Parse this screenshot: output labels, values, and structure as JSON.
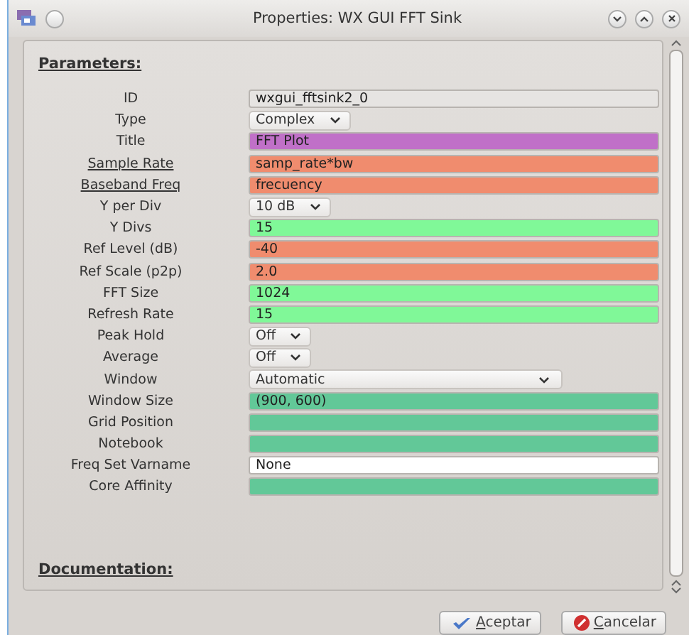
{
  "window": {
    "title": "Properties: WX GUI FFT Sink"
  },
  "parameters_heading": "Parameters:",
  "parameters": [
    {
      "label": "ID",
      "kind": "entry",
      "value": "wxgui_fftsink2_0",
      "color": "#e6e4e2",
      "underlined": false
    },
    {
      "label": "Type",
      "kind": "dropdown",
      "value": "Complex",
      "underlined": false
    },
    {
      "label": "Title",
      "kind": "entry",
      "value": "FFT Plot",
      "color": "#c070c8",
      "underlined": false
    },
    {
      "label": "Sample Rate",
      "kind": "entry",
      "value": "samp_rate*bw",
      "color": "#f08c6e",
      "underlined": true
    },
    {
      "label": "Baseband Freq",
      "kind": "entry",
      "value": "frecuency",
      "color": "#f08c6e",
      "underlined": true
    },
    {
      "label": "Y per Div",
      "kind": "dropdown",
      "value": "10 dB",
      "underlined": false
    },
    {
      "label": "Y Divs",
      "kind": "entry",
      "value": "15",
      "color": "#80f898",
      "underlined": false
    },
    {
      "label": "Ref Level (dB)",
      "kind": "entry",
      "value": "-40",
      "color": "#f08c6e",
      "underlined": false
    },
    {
      "label": "Ref Scale (p2p)",
      "kind": "entry",
      "value": "2.0",
      "color": "#f08c6e",
      "underlined": false
    },
    {
      "label": "FFT Size",
      "kind": "entry",
      "value": "1024",
      "color": "#80f898",
      "underlined": false
    },
    {
      "label": "Refresh Rate",
      "kind": "entry",
      "value": "15",
      "color": "#80f898",
      "underlined": false
    },
    {
      "label": "Peak Hold",
      "kind": "dropdown",
      "value": "Off",
      "underlined": false
    },
    {
      "label": "Average",
      "kind": "dropdown",
      "value": "Off",
      "underlined": false
    },
    {
      "label": "Window",
      "kind": "dropdown",
      "value": "Automatic",
      "underlined": false
    },
    {
      "label": "Window Size",
      "kind": "entry",
      "value": "(900, 600)",
      "color": "#62c898",
      "underlined": false
    },
    {
      "label": "Grid Position",
      "kind": "entry",
      "color": "#62c898",
      "underlined": false
    },
    {
      "label": "Notebook",
      "kind": "entry",
      "color": "#62c898",
      "underlined": false
    },
    {
      "label": "Freq Set Varname",
      "kind": "entry",
      "value": "None",
      "color": "#ffffff",
      "underlined": false
    },
    {
      "label": "Core Affinity",
      "kind": "entry",
      "color": "#62c898",
      "underlined": false
    }
  ],
  "documentation_heading": "Documentation:",
  "buttons": [
    {
      "label": "Aceptar",
      "kind": "accept"
    },
    {
      "label": "Cancelar",
      "kind": "cancel"
    }
  ]
}
